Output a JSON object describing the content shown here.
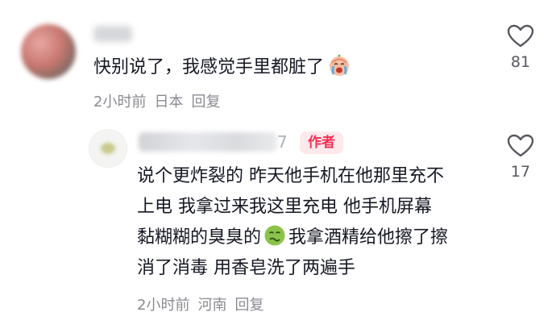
{
  "top_comment": {
    "text": "快别说了，我感觉手里都脏了",
    "emoji": "crying-face-emoji",
    "time": "2小时前",
    "location": "日本",
    "reply_label": "回复",
    "likes": "81"
  },
  "reply_comment": {
    "name_tail": "7",
    "author_badge": "作者",
    "lines": [
      "说个更炸裂的 昨天他手机在他那里充不",
      "上电 我拿过来我这里充电 他手机屏幕",
      "黏糊糊的臭臭的",
      "我拿酒精给他擦了擦",
      "消了消毒 用香皂洗了两遍手"
    ],
    "emoji": "nauseated-face-emoji",
    "time": "2小时前",
    "location": "河南",
    "reply_label": "回复",
    "likes": "17"
  },
  "colors": {
    "text": "#161823",
    "meta": "#8a8b91",
    "badge_bg": "#fde9ec",
    "badge_text": "#fe2c55",
    "heart_stroke": "#57585e"
  }
}
